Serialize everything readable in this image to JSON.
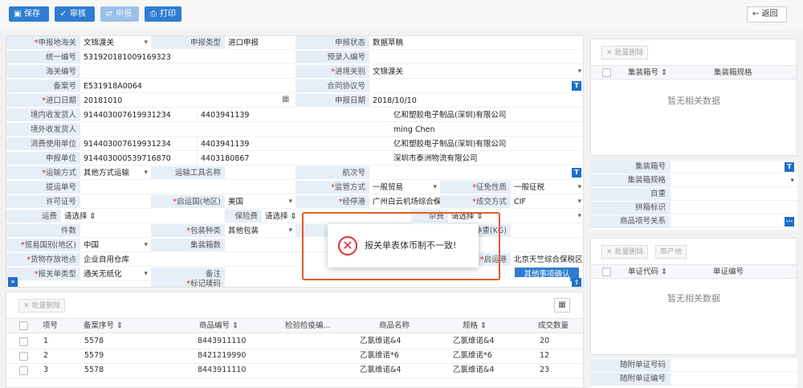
{
  "toolbar": {
    "save": "保存",
    "review": "审核",
    "declare": "申报",
    "print": "打印",
    "back": "返回"
  },
  "form": {
    "decl_customs_label": "申报地海关",
    "decl_customs_value": "文锦渡关",
    "decl_type_label": "申报类型",
    "decl_type_value": "进口申报",
    "decl_status_label": "申报状态",
    "decl_status_value": "数据草稿",
    "unified_no_label": "统一编号",
    "unified_no_value": "531920181009169323",
    "preentry_no_label": "预录入编号",
    "preentry_no_value": "",
    "customs_no_label": "海关编号",
    "customs_no_value": "",
    "entry_customs_label": "进境关别",
    "entry_customs_value": "文锦渡关",
    "record_no_label": "备案号",
    "record_no_value": "E531918A0064",
    "contract_no_label": "合同协议号",
    "contract_no_value": "",
    "import_date_label": "进口日期",
    "import_date_value": "20181010",
    "decl_date_label": "申报日期",
    "decl_date_value": "2018/10/10",
    "domestic_consignee_label": "境内收发货人",
    "domestic_consignee_code": "914403007619931234",
    "domestic_consignee_code2": "4403941139",
    "domestic_consignee_name": "亿和塑胶电子制品(深圳)有限公司",
    "foreign_consignee_label": "境外收发货人",
    "foreign_consignee_name": "ming Chen",
    "consumer_unit_label": "消费使用单位",
    "consumer_unit_code": "914403007619931234",
    "consumer_unit_code2": "4403941139",
    "consumer_unit_name": "亿和塑胶电子制品(深圳)有限公司",
    "declarant_label": "申报单位",
    "declarant_code": "914403000539716870",
    "declarant_code2": "4403180867",
    "declarant_name": "深圳市泰洲物流有限公司",
    "transport_mode_label": "运输方式",
    "transport_mode_value": "其他方式运输",
    "transport_tool_label": "运输工具名称",
    "transport_tool_value": "",
    "voyage_label": "航次号",
    "voyage_value": "",
    "bill_no_label": "提运单号",
    "bill_no_value": "",
    "supervision_label": "监管方式",
    "supervision_value": "一般贸易",
    "exemption_label": "征免性质",
    "exemption_value": "一般征税",
    "license_label": "许可证号",
    "license_value": "",
    "origin_country_label": "启运国(地区)",
    "origin_country_value": "美国",
    "stop_port_label": "经停港",
    "stop_port_value": "广州白云机场综合保",
    "deal_mode_label": "成交方式",
    "deal_mode_value": "CIF",
    "freight_label": "运费",
    "freight_value": "请选择",
    "insurance_label": "保险费",
    "insurance_value": "请选择",
    "misc_label": "杂费",
    "misc_value": "请选择",
    "pieces_label": "件数",
    "pieces_value": "",
    "package_label": "包装种类",
    "package_value": "其他包装",
    "gross_weight_label": "毛重(KG)",
    "net_weight_label": "净重(KG)",
    "trade_country_label": "贸易国别(地区)",
    "trade_country_value": "中国",
    "container_count_label": "集装箱数",
    "container_count_value": "",
    "goods_place_label": "货物存放地点",
    "goods_place_value": "企业自用仓库",
    "departure_port_label": "启运港",
    "departure_port_value": "北京天竺综合保税区",
    "decl_form_type_label": "报关单类型",
    "decl_form_type_value": "通关无纸化",
    "remark_label": "备注",
    "remark_value": "",
    "mark_label": "标记唛码",
    "mark_value": "",
    "other_confirm": "其他事项确认",
    "badge_t": "T"
  },
  "dialog": {
    "message": "报关单表体币制不一致!"
  },
  "goods": {
    "batch_delete": "批量删除",
    "headers": [
      "项号",
      "备案序号",
      "商品编号",
      "检验检疫编...",
      "商品名称",
      "规格",
      "成交数量"
    ],
    "rows": [
      {
        "no": "1",
        "record_seq": "5578",
        "code": "8443911110",
        "name": "乙氯维诺&4",
        "spec": "乙氯维诺&4",
        "qty": "20"
      },
      {
        "no": "2",
        "record_seq": "5579",
        "code": "8421219990",
        "name": "乙氯维诺*6",
        "spec": "乙氯维诺*6",
        "qty": "12"
      },
      {
        "no": "3",
        "record_seq": "5578",
        "code": "8443911110",
        "name": "乙氯维诺&4",
        "spec": "乙氯维诺&4",
        "qty": "23"
      }
    ]
  },
  "container": {
    "batch_delete": "批量删除",
    "col_no": "集装箱号",
    "col_spec": "集装箱规格",
    "no_data": "暂无相关数据",
    "f_no": "集装箱号",
    "f_spec": "集装箱规格",
    "f_weight": "自重",
    "f_lcl": "拼箱标识",
    "f_relation": "商品项号关系",
    "badge_t": "T"
  },
  "documents": {
    "batch_delete": "批量删除",
    "gen_doc": "带产地",
    "col_code": "单证代码",
    "col_no": "单证编号",
    "no_data": "暂无相关数据",
    "attach_code": "随附单证号码",
    "attach_no": "随附单证编号"
  }
}
